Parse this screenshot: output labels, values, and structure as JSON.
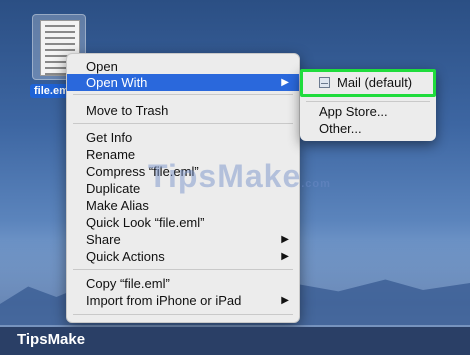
{
  "desktop": {
    "file_label": "file.eml"
  },
  "context_menu": {
    "items": [
      {
        "label": "Open"
      },
      {
        "label": "Open With"
      },
      {
        "label": "Move to Trash"
      },
      {
        "label": "Get Info"
      },
      {
        "label": "Rename"
      },
      {
        "label": "Compress “file.eml”"
      },
      {
        "label": "Duplicate"
      },
      {
        "label": "Make Alias"
      },
      {
        "label": "Quick Look “file.eml”"
      },
      {
        "label": "Share"
      },
      {
        "label": "Quick Actions"
      },
      {
        "label": "Copy “file.eml”"
      },
      {
        "label": "Import from iPhone or iPad"
      }
    ],
    "arrow": "▶"
  },
  "submenu": {
    "items": [
      {
        "label": "Mail (default)",
        "icon": "mail-app-icon"
      },
      {
        "label": "App Store..."
      },
      {
        "label": "Other..."
      }
    ],
    "highlight_color": "#1fdc3c"
  },
  "watermark": {
    "text": "TipsMake",
    "suffix": ".com"
  },
  "brand": {
    "text": "TipsMake"
  },
  "colors": {
    "selection": "#2a68dc",
    "menu_bg": "#ececec",
    "brand_bar": "#2a3f66"
  }
}
